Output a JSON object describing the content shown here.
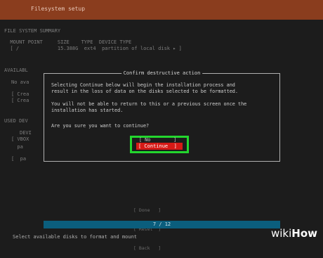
{
  "window": {
    "title": "Filesystem setup"
  },
  "background": {
    "summary_header": "FILE SYSTEM SUMMARY",
    "summary_columns": "  MOUNT POINT     SIZE    TYPE  DEVICE TYPE",
    "summary_row": "  [ /             15.388G  ext4  partition of local disk ▸ ]",
    "available_header": "AVAILABL",
    "available_items": [
      "No ava",
      "[ Crea",
      "[ Crea"
    ],
    "used_header": "USED DEV",
    "used_items": [
      "DEVI",
      "[ VBOX",
      "  pa",
      "[  pa"
    ]
  },
  "dialog": {
    "title": "Confirm destructive action",
    "line1": "Selecting Continue below will begin the installation process and",
    "line2": "result in the loss of data on the disks selected to be formatted.",
    "line3": "You will not be able to return to this or a previous screen once the",
    "line4": "installation has started.",
    "question": "Are you sure you want to continue?",
    "buttons": {
      "no": "[ No        ]",
      "continue": "[ Continue  ]"
    }
  },
  "bottom_nav": {
    "done": "[ Done   ]",
    "reset": "[ Reset  ]",
    "back": "[ Back   ]"
  },
  "progress": {
    "label": "7 / 12",
    "fraction": 0.58
  },
  "status": {
    "message": "Select available disks to format and mount"
  },
  "watermark": {
    "wiki": "wiki",
    "how": "How"
  }
}
